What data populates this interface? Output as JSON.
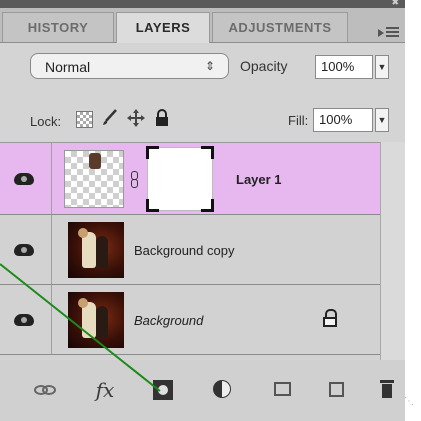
{
  "tabs": [
    {
      "label": "HISTORY",
      "active": false
    },
    {
      "label": "LAYERS",
      "active": true
    },
    {
      "label": "ADJUSTMENTS",
      "active": false
    }
  ],
  "blend_mode": {
    "value": "Normal"
  },
  "opacity": {
    "label": "Opacity",
    "value": "100%"
  },
  "lock": {
    "label": "Lock:"
  },
  "fill": {
    "label": "Fill:",
    "value": "100%"
  },
  "layers": [
    {
      "name": "Layer 1",
      "selected": true,
      "visible": true,
      "has_mask": true
    },
    {
      "name": "Background copy",
      "selected": false,
      "visible": true
    },
    {
      "name": "Background",
      "selected": false,
      "visible": true,
      "locked": true
    }
  ],
  "footer": {
    "fx_label": "fx"
  },
  "colors": {
    "selected_row": "#e6b8ef",
    "annotation_line": "#1a8a1a"
  }
}
